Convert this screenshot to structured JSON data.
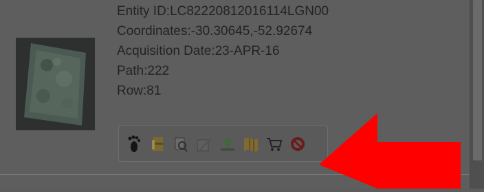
{
  "scene": {
    "fields": [
      {
        "label": "Entity ID:",
        "value": "LC82220812016114LGN00"
      },
      {
        "label": "Coordinates:",
        "value": "-30.30645,-52.92674"
      },
      {
        "label": "Acquisition Date:",
        "value": "23-APR-16"
      },
      {
        "label": "Path:",
        "value": "222"
      },
      {
        "label": "Row:",
        "value": "81"
      }
    ],
    "toolbar": [
      {
        "icon": "footprint-icon",
        "color": "#151515"
      },
      {
        "icon": "metadata-icon",
        "color": "#8a7a3a"
      },
      {
        "icon": "compare-icon",
        "color": "#4a4a4a"
      },
      {
        "icon": "bulk-download-icon",
        "color": "#5a5a5a"
      },
      {
        "icon": "download-icon",
        "color": "#4d7040"
      },
      {
        "icon": "order-scene-icon",
        "color": "#8a7030"
      },
      {
        "icon": "shopping-cart-icon",
        "color": "#2b2b2b"
      },
      {
        "icon": "exclude-scene-icon",
        "color": "#7a2020"
      }
    ]
  },
  "annotation": {
    "color": "#ff0000",
    "direction": "left",
    "shape": "arrow"
  }
}
